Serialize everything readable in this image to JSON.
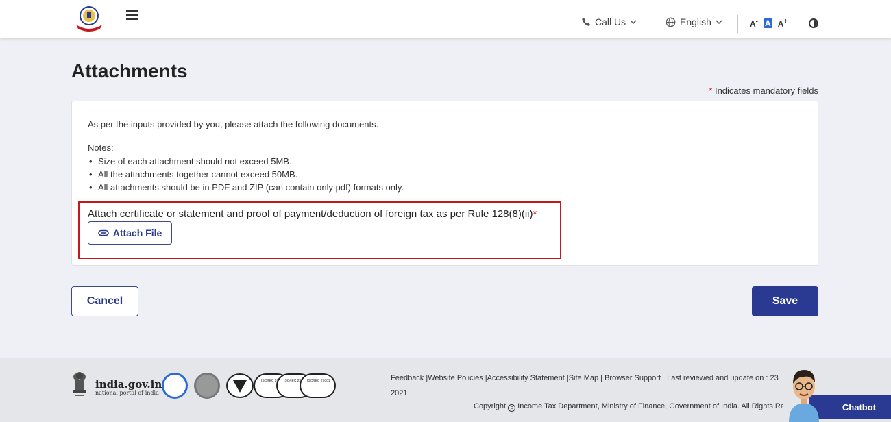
{
  "header": {
    "call_us": "Call Us",
    "language": "English",
    "font_decrease": "A",
    "font_normal": "A",
    "font_increase": "A"
  },
  "page": {
    "title": "Attachments",
    "mandatory_star": "*",
    "mandatory_note": "Indicates mandatory fields"
  },
  "card": {
    "intro": "As per the inputs provided by you, please attach the following documents.",
    "notes_title": "Notes:",
    "notes": [
      "Size of each attachment should not exceed 5MB.",
      "All the attachments together cannot exceed 50MB.",
      "All attachments should be in PDF and ZIP (can contain only pdf) formats only."
    ],
    "attach_label": "Attach certificate or statement and proof of payment/deduction of foreign tax as per Rule 128(8)(ii)",
    "attach_star": "*",
    "attach_button": "Attach File"
  },
  "actions": {
    "cancel": "Cancel",
    "save": "Save"
  },
  "footer": {
    "india_gov": "india.gov.in",
    "india_gov_sub": "national portal of india",
    "cert_labels": [
      "ISO/IEC 20000-1",
      "ISO/IEC 22301",
      "ISO/IEC 27001"
    ],
    "links": {
      "feedback": "Feedback",
      "website_policies": "Website Policies",
      "accessibility": "Accessibility Statement",
      "site_map": "Site Map",
      "browser_support": "Browser Support"
    },
    "last_reviewed": "Last reviewed and update on : 23",
    "year": "2021",
    "copyright": "Copyright",
    "copyright_text": "Income Tax Department, Ministry of Finance, Government of India. All Rights Reserved"
  },
  "chatbot": {
    "label": "Chatbot"
  },
  "colors": {
    "primary": "#2a3a92",
    "highlight": "#c4181e",
    "required": "#d21f1f"
  }
}
